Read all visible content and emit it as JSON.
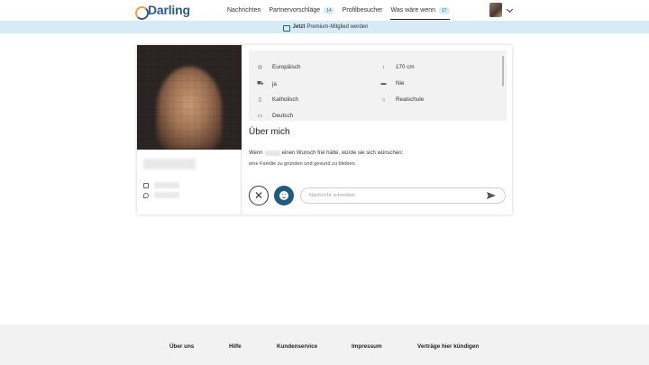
{
  "brand": {
    "logo_text": "Darling",
    "accent": "#f2a23a",
    "primary": "#2a5d8c"
  },
  "nav": {
    "items": [
      {
        "label": "Nachrichten",
        "badge": ""
      },
      {
        "label": "Partnervorschläge",
        "badge": "14"
      },
      {
        "label": "Profilbesucher",
        "badge": ""
      },
      {
        "label": "Was wäre wenn",
        "badge": "17"
      }
    ],
    "active_index": 3
  },
  "premium": {
    "bold": "Jetzt",
    "text": "Premium-Mitglied werden",
    "background": "#d6ebf6"
  },
  "profile": {
    "attributes": [
      {
        "icon": "globe-icon",
        "label": "Europäisch"
      },
      {
        "icon": "height-icon",
        "label": "170 cm"
      },
      {
        "icon": "stroller-icon",
        "label": "ja"
      },
      {
        "icon": "smoking-icon",
        "label": "Nie"
      },
      {
        "icon": "book-icon",
        "label": "Katholisch"
      },
      {
        "icon": "graduation-cap-icon",
        "label": "Realschule"
      },
      {
        "icon": "speech-bubble-icon",
        "label": "Deutsch"
      }
    ],
    "about_title": "Über mich",
    "wish_prefix": "Wenn",
    "wish_suffix": "einen Wunsch frei hätte, würde sie sich wünschen:",
    "wish_answer": "eine Familie zu gründen und gesund zu bleiben."
  },
  "message": {
    "placeholder": "Nachricht schreiben"
  },
  "footer": {
    "links": [
      "Über uns",
      "Hilfe",
      "Kundenservice",
      "Impressum",
      "Verträge hier kündigen"
    ]
  }
}
